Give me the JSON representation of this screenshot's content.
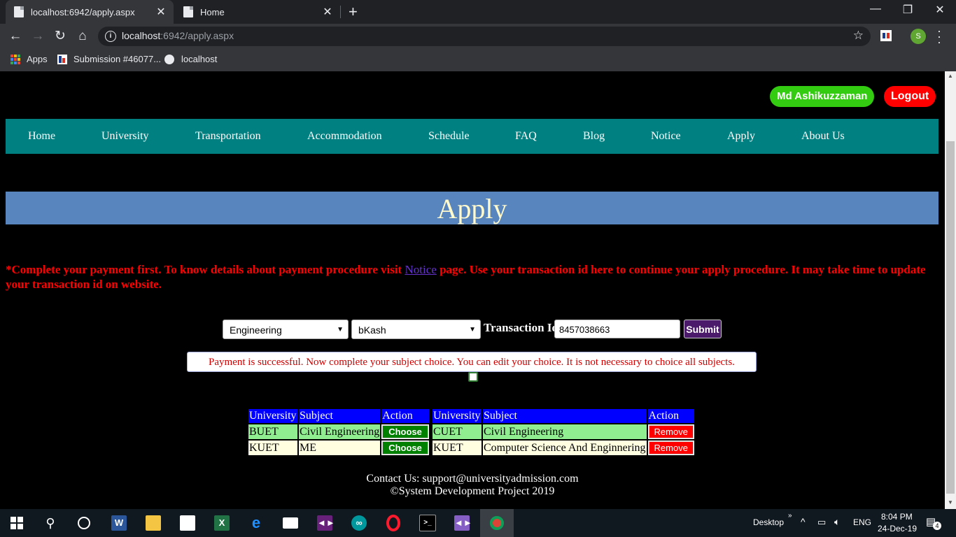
{
  "browser": {
    "tabs": [
      {
        "title": "localhost:6942/apply.aspx",
        "active": true
      },
      {
        "title": "Home",
        "active": false
      }
    ],
    "url_host": "localhost",
    "url_rest": ":6942/apply.aspx",
    "profile_initial": "S",
    "bookmarks": [
      "Apps",
      "Submission #46077...",
      "localhost"
    ]
  },
  "page": {
    "user_name": "Md Ashikuzzaman",
    "logout_label": "Logout",
    "nav": [
      "Home",
      "University",
      "Transportation",
      "Accommodation",
      "Schedule",
      "FAQ",
      "Blog",
      "Notice",
      "Apply",
      "About Us"
    ],
    "banner_title": "Apply",
    "notice": {
      "before": "*Complete your payment first. To know details about payment procedure visit ",
      "link": "Notice",
      "after": " page. Use your transaction id here to continue your apply procedure. It may take time to update your transaction id on website."
    },
    "form": {
      "category_value": "Engineering",
      "payment_method_value": "bKash",
      "transaction_label": "Transaction Id:",
      "transaction_value": "8457038663",
      "submit_label": "Submit"
    },
    "success_message": "Payment is successful. Now complete your subject choice. You can edit your choice. It is not necessary to choice all subjects.",
    "available_table": {
      "headers": [
        "University",
        "Subject",
        "Action"
      ],
      "rows": [
        {
          "university": "BUET",
          "subject": "Civil Engineering",
          "action": "Choose"
        },
        {
          "university": "KUET",
          "subject": "ME",
          "action": "Choose"
        }
      ]
    },
    "chosen_table": {
      "headers": [
        "University",
        "Subject",
        "Action"
      ],
      "rows": [
        {
          "university": "CUET",
          "subject": "Civil Engineering",
          "action": "Remove"
        },
        {
          "university": "KUET",
          "subject": "Computer Science And Enginnering",
          "action": "Remove"
        }
      ]
    },
    "footer_contact": "Contact Us: support@universityadmission.com",
    "footer_copyright": "©System Development Project 2019"
  },
  "taskbar": {
    "desktop_label": "Desktop",
    "language": "ENG",
    "time": "8:04 PM",
    "date": "24-Dec-19",
    "notification_count": "4"
  }
}
